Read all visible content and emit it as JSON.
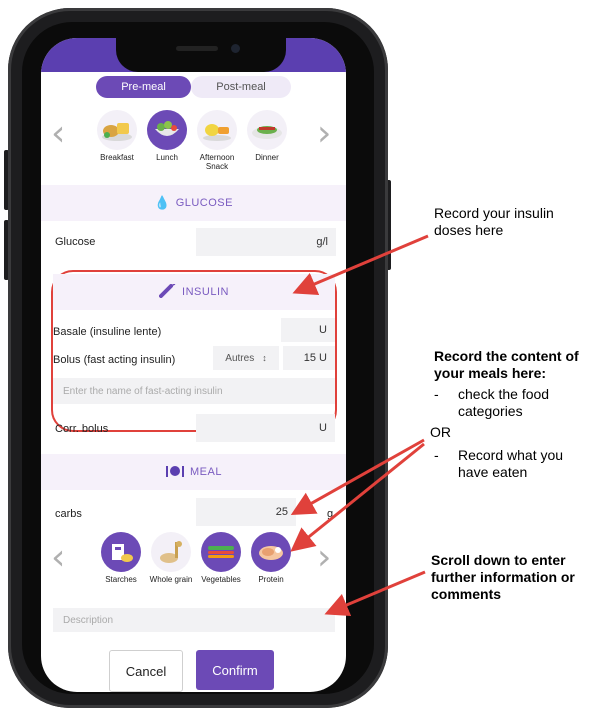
{
  "tabs": {
    "pre_meal": "Pre-meal",
    "post_meal": "Post-meal"
  },
  "meal_types": [
    {
      "label": "Breakfast",
      "icon": "breakfast-food-icon"
    },
    {
      "label": "Lunch",
      "icon": "lunch-salad-icon"
    },
    {
      "label": "Afternoon Snack",
      "icon": "snack-icon"
    },
    {
      "label": "Dinner",
      "icon": "dinner-plate-icon"
    }
  ],
  "glucose": {
    "section_title": "GLUCOSE",
    "label": "Glucose",
    "unit": "g/l"
  },
  "insulin": {
    "section_title": "INSULIN",
    "basale_label": "Basale (insuline lente)",
    "basale_unit": "U",
    "bolus_label": "Bolus (fast acting insulin)",
    "bolus_type": "Autres",
    "bolus_value": "15 U",
    "name_placeholder": "Enter the name of fast-acting insulin",
    "corr_label": "Corr. bolus",
    "corr_unit": "U"
  },
  "meal": {
    "section_title": "MEAL",
    "carbs_label": "carbs",
    "carbs_value": "25",
    "carbs_unit": "g",
    "categories": [
      {
        "label": "Starches",
        "icon": "starches-icon"
      },
      {
        "label": "Whole grain",
        "icon": "whole-grain-icon"
      },
      {
        "label": "Vegetables",
        "icon": "vegetables-icon"
      },
      {
        "label": "Protein",
        "icon": "protein-icon"
      }
    ],
    "description_placeholder": "Description"
  },
  "buttons": {
    "cancel": "Cancel",
    "confirm": "Confirm"
  },
  "annotations": {
    "insulin_note": "Record your insulin doses here",
    "meal_title": "Record the content of your meals here:",
    "meal_bullet1": "check the food categories",
    "meal_or": "OR",
    "meal_bullet2": "Record what you have eaten",
    "scroll_note": "Scroll down to enter further information or comments"
  },
  "colors": {
    "brand": "#6c4ab6",
    "highlight": "#e0413b"
  }
}
